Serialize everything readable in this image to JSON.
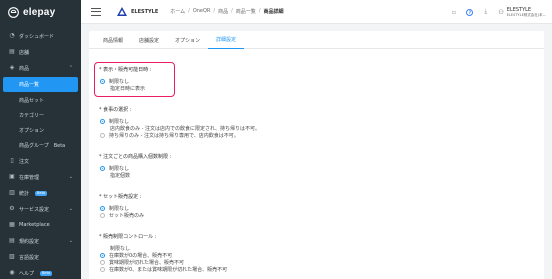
{
  "app": {
    "brand": "elepay"
  },
  "sidebar": {
    "items": [
      {
        "label": "ダッシュボード",
        "icon": "dashboard-icon",
        "glyph": "◔"
      },
      {
        "label": "店舗",
        "icon": "store-icon",
        "glyph": "▤"
      },
      {
        "label": "商品",
        "icon": "tag-icon",
        "glyph": "◈"
      },
      {
        "label": "注文",
        "icon": "receipt-icon",
        "glyph": "▯"
      },
      {
        "label": "在庫管理",
        "icon": "box-icon",
        "glyph": "▣"
      },
      {
        "label": "統計",
        "icon": "chart-icon",
        "glyph": "▥",
        "badge": "Beta"
      },
      {
        "label": "サービス設定",
        "icon": "settings-icon",
        "glyph": "⚙"
      },
      {
        "label": "Marketplace",
        "icon": "marketplace-icon",
        "glyph": "▦"
      },
      {
        "label": "規約設定",
        "icon": "document-icon",
        "glyph": "▤"
      },
      {
        "label": "言語設定",
        "icon": "language-icon",
        "glyph": "▧"
      },
      {
        "label": "ヘルプ",
        "icon": "help-icon",
        "glyph": "◉",
        "badge": "Beta"
      }
    ],
    "sub_items": [
      {
        "label": "商品一覧"
      },
      {
        "label": "商品セット"
      },
      {
        "label": "カテゴリー"
      },
      {
        "label": "オプション"
      },
      {
        "label": "商品グループ",
        "badge": "Beta"
      }
    ]
  },
  "header": {
    "logo_name": "ELESTYLE",
    "breadcrumbs": [
      "ホーム",
      "OneQR",
      "商品",
      "商品一覧",
      "商品詳細"
    ],
    "separator": "/",
    "user_name": "ELESTYLE",
    "user_company": "ELESTYLE株式会社(本..."
  },
  "tabs": [
    {
      "label": "商品情報"
    },
    {
      "label": "店舗設定"
    },
    {
      "label": "オプション"
    },
    {
      "label": "詳細設定"
    }
  ],
  "sections": {
    "display_period": {
      "label": "* 表示・販売可能日時 :",
      "options": [
        "制限なし",
        "指定日時に表示"
      ]
    },
    "meal_choice": {
      "label": "* 食事の選択 :",
      "options": [
        "制限なし",
        "店内飲食のみ - 注文は店内での飲食に限定され、持ち帰りは不可。",
        "持ち帰りのみ - 注文は持ち帰り専用で、店内飲食は不可。"
      ]
    },
    "max_per_order": {
      "label": "* 注文ごとの商品購入個数制限 :",
      "options": [
        "制限なし",
        "指定個数"
      ]
    },
    "set_sale": {
      "label": "* セット販売設定 :",
      "options": [
        "制限なし",
        "セット販売のみ"
      ]
    },
    "sales_control": {
      "label": "* 販売制限コントロール :",
      "options": [
        "制限なし",
        "在庫数が0の場合、販売不可",
        "賞味期限が切れた場合、販売不可",
        "在庫数が0、または賞味期限が切れた場合、販売不可"
      ]
    }
  }
}
